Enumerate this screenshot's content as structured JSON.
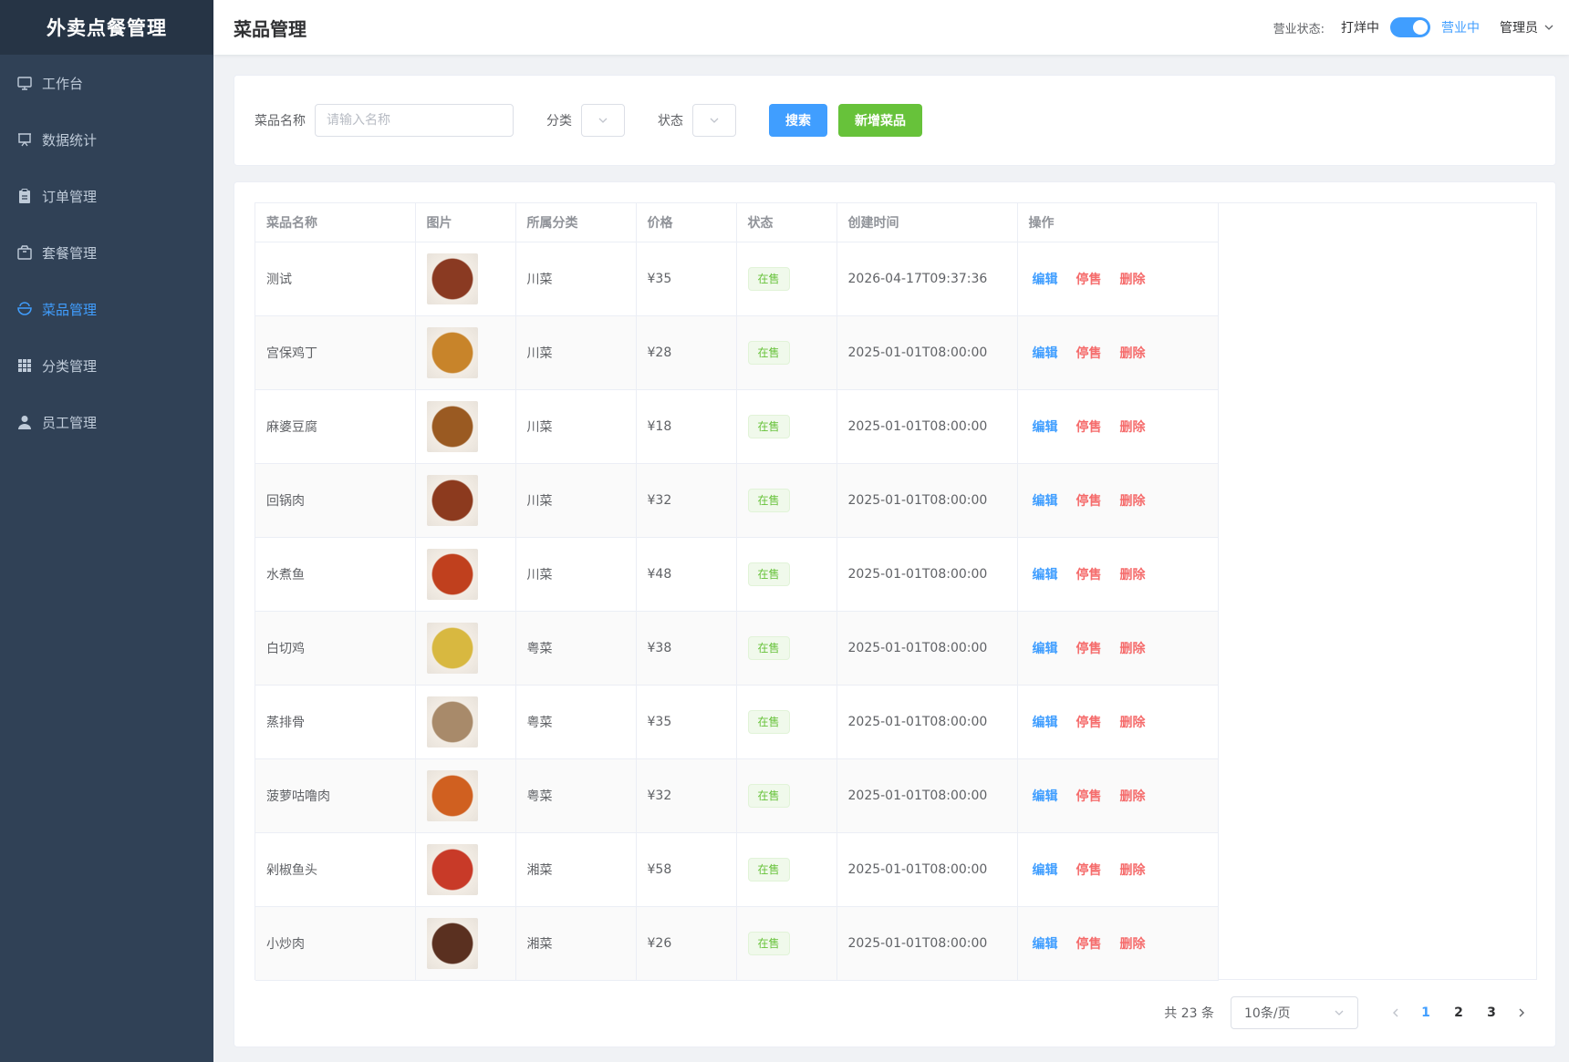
{
  "app": {
    "title": "外卖点餐管理"
  },
  "sidebar": {
    "items": [
      {
        "label": "工作台",
        "icon": "monitor-icon",
        "active": false
      },
      {
        "label": "数据统计",
        "icon": "presentation-icon",
        "active": false
      },
      {
        "label": "订单管理",
        "icon": "clipboard-icon",
        "active": false
      },
      {
        "label": "套餐管理",
        "icon": "package-icon",
        "active": false
      },
      {
        "label": "菜品管理",
        "icon": "bowl-icon",
        "active": true
      },
      {
        "label": "分类管理",
        "icon": "grid-icon",
        "active": false
      },
      {
        "label": "员工管理",
        "icon": "user-icon",
        "active": false
      }
    ]
  },
  "header": {
    "title": "菜品管理",
    "business_label": "营业状态:",
    "business_off": "打烊中",
    "business_on": "营业中",
    "user": "管理员"
  },
  "search": {
    "name_label": "菜品名称",
    "name_placeholder": "请输入名称",
    "category_label": "分类",
    "status_label": "状态",
    "search_button": "搜索",
    "add_button": "新增菜品"
  },
  "table": {
    "columns": [
      "菜品名称",
      "图片",
      "所属分类",
      "价格",
      "状态",
      "创建时间",
      "操作"
    ],
    "actions": {
      "edit": "编辑",
      "stop": "停售",
      "delete": "删除"
    },
    "rows": [
      {
        "name": "测试",
        "category": "川菜",
        "price": "¥35",
        "status": "在售",
        "created": "2026-04-17T09:37:36",
        "img": "#8a3a22"
      },
      {
        "name": "宫保鸡丁",
        "category": "川菜",
        "price": "¥28",
        "status": "在售",
        "created": "2025-01-01T08:00:00",
        "img": "#c8842a"
      },
      {
        "name": "麻婆豆腐",
        "category": "川菜",
        "price": "¥18",
        "status": "在售",
        "created": "2025-01-01T08:00:00",
        "img": "#9a5a22"
      },
      {
        "name": "回锅肉",
        "category": "川菜",
        "price": "¥32",
        "status": "在售",
        "created": "2025-01-01T08:00:00",
        "img": "#8c3a1e"
      },
      {
        "name": "水煮鱼",
        "category": "川菜",
        "price": "¥48",
        "status": "在售",
        "created": "2025-01-01T08:00:00",
        "img": "#c0401e"
      },
      {
        "name": "白切鸡",
        "category": "粤菜",
        "price": "¥38",
        "status": "在售",
        "created": "2025-01-01T08:00:00",
        "img": "#d8b840"
      },
      {
        "name": "蒸排骨",
        "category": "粤菜",
        "price": "¥35",
        "status": "在售",
        "created": "2025-01-01T08:00:00",
        "img": "#a88a6a"
      },
      {
        "name": "菠萝咕噜肉",
        "category": "粤菜",
        "price": "¥32",
        "status": "在售",
        "created": "2025-01-01T08:00:00",
        "img": "#d06020"
      },
      {
        "name": "剁椒鱼头",
        "category": "湘菜",
        "price": "¥58",
        "status": "在售",
        "created": "2025-01-01T08:00:00",
        "img": "#c83a28"
      },
      {
        "name": "小炒肉",
        "category": "湘菜",
        "price": "¥26",
        "status": "在售",
        "created": "2025-01-01T08:00:00",
        "img": "#5a3020"
      }
    ]
  },
  "pagination": {
    "total": "共 23 条",
    "page_size": "10条/页",
    "pages": [
      "1",
      "2",
      "3"
    ],
    "current": "1"
  }
}
